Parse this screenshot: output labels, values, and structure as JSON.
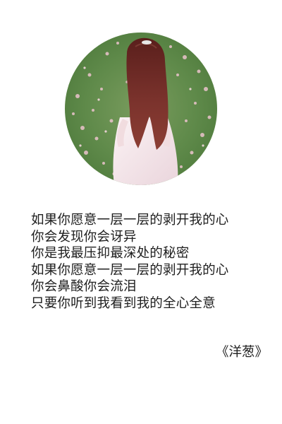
{
  "photo": {
    "description_icon": "girl-in-flower-field-photo"
  },
  "poem": {
    "lines": [
      "如果你愿意一层一层的剥开我的心",
      "你会发现你会讶异",
      "你是我最压抑最深处的秘密",
      "如果你愿意一层一层的剥开我的心",
      "你会鼻酸你会流泪",
      "只要你听到我看到我的全心全意"
    ]
  },
  "signature": {
    "text": "《洋葱》"
  },
  "colors": {
    "background": "#ffffff",
    "text": "#202020",
    "grass": "#5f8a4a",
    "petals": "#e8b8c4",
    "hair": "#6b2a26",
    "dress": "#f3e6ea"
  }
}
